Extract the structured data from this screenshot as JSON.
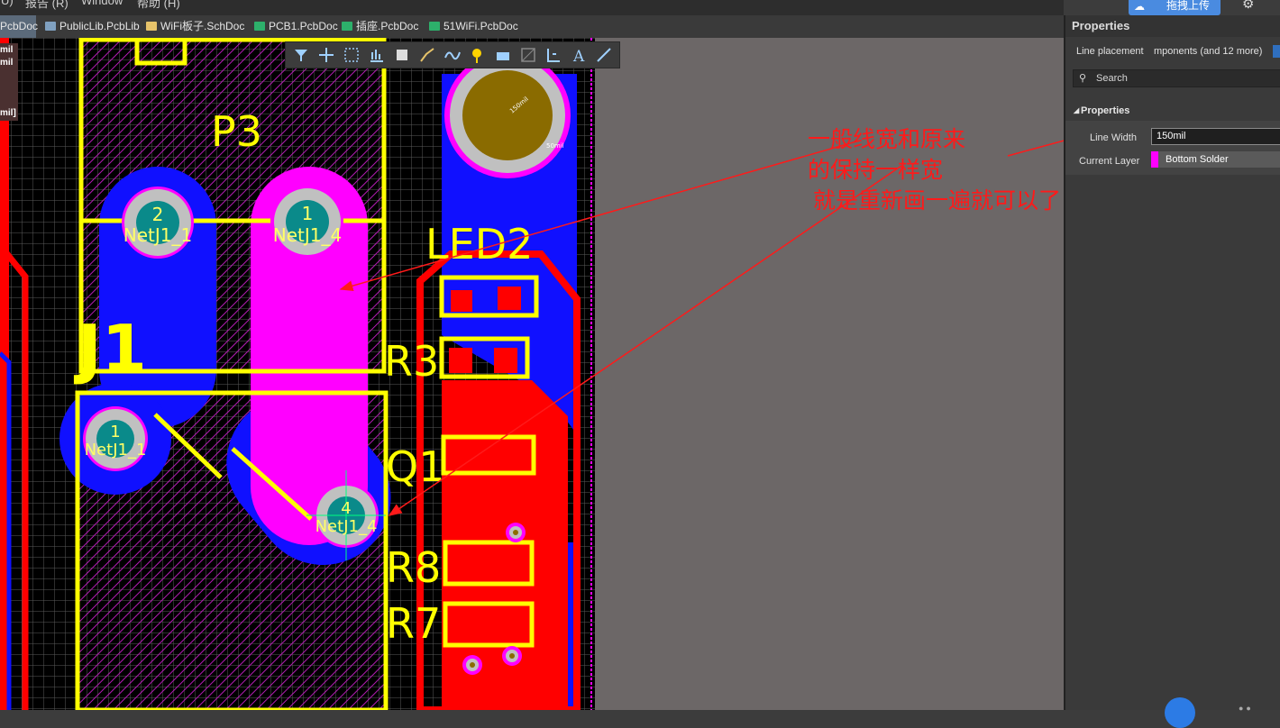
{
  "menu": {
    "item0": "U)",
    "item1": "报告 (R)",
    "item2": "Window",
    "item3": "帮助 (H)"
  },
  "tabs": [
    {
      "label": "PcbDoc",
      "icon": "pcb-doc-icon"
    },
    {
      "label": "PublicLib.PcbLib",
      "icon": "pcblib-icon"
    },
    {
      "label": "WiFi板子.SchDoc",
      "icon": "schematic-icon"
    },
    {
      "label": "PCB1.PcbDoc",
      "icon": "pcb-doc-icon"
    },
    {
      "label": "插座.PcbDoc",
      "icon": "pcb-doc-icon"
    },
    {
      "label": "51WiFi.PcbDoc",
      "icon": "pcb-doc-icon"
    }
  ],
  "left_strip": {
    "line1": "mil",
    "line2": "mil",
    "line3": "mil]"
  },
  "pcb": {
    "comp_p3": "P3",
    "comp_j1": "J1",
    "comp_led2": "LED2",
    "comp_r3": "R3",
    "comp_q1": "Q1",
    "comp_r8": "R8",
    "comp_r7": "R7",
    "pad1_num": "2",
    "pad1_net": "NetJ1_1",
    "pad2_num": "1",
    "pad2_net": "NetJ1_4",
    "pad3_num": "1",
    "pad3_net": "NetJ1_1",
    "pad4_num": "4",
    "pad4_net": "NetJ1_4",
    "hole_dim1": "150mil",
    "hole_dim2": "50mil",
    "hole_dim3": "50mil"
  },
  "annotation": {
    "line1": "一般线宽和原来",
    "line2": "的保持一样宽",
    "line3": "就是重新画一遍就可以了",
    "color": "#ff1a1a"
  },
  "panel": {
    "title": "Properties",
    "filter_label": "Line placement",
    "filter_value": "mponents (and 12 more)",
    "search_placeholder": "Search",
    "section_title": "Properties",
    "line_width_label": "Line Width",
    "line_width_value": "150mil",
    "current_layer_label": "Current Layer",
    "current_layer_value": "Bottom Solder",
    "layer_color": "#ff00ff"
  },
  "upload_button": "拖拽上传",
  "colors": {
    "top_copper": "#ff0000",
    "bottom_copper": "#1010ff",
    "overlay": "#ffff00",
    "solder": "#ff00ff",
    "board_bg": "#000000",
    "canvas_bg": "#6c6767"
  }
}
